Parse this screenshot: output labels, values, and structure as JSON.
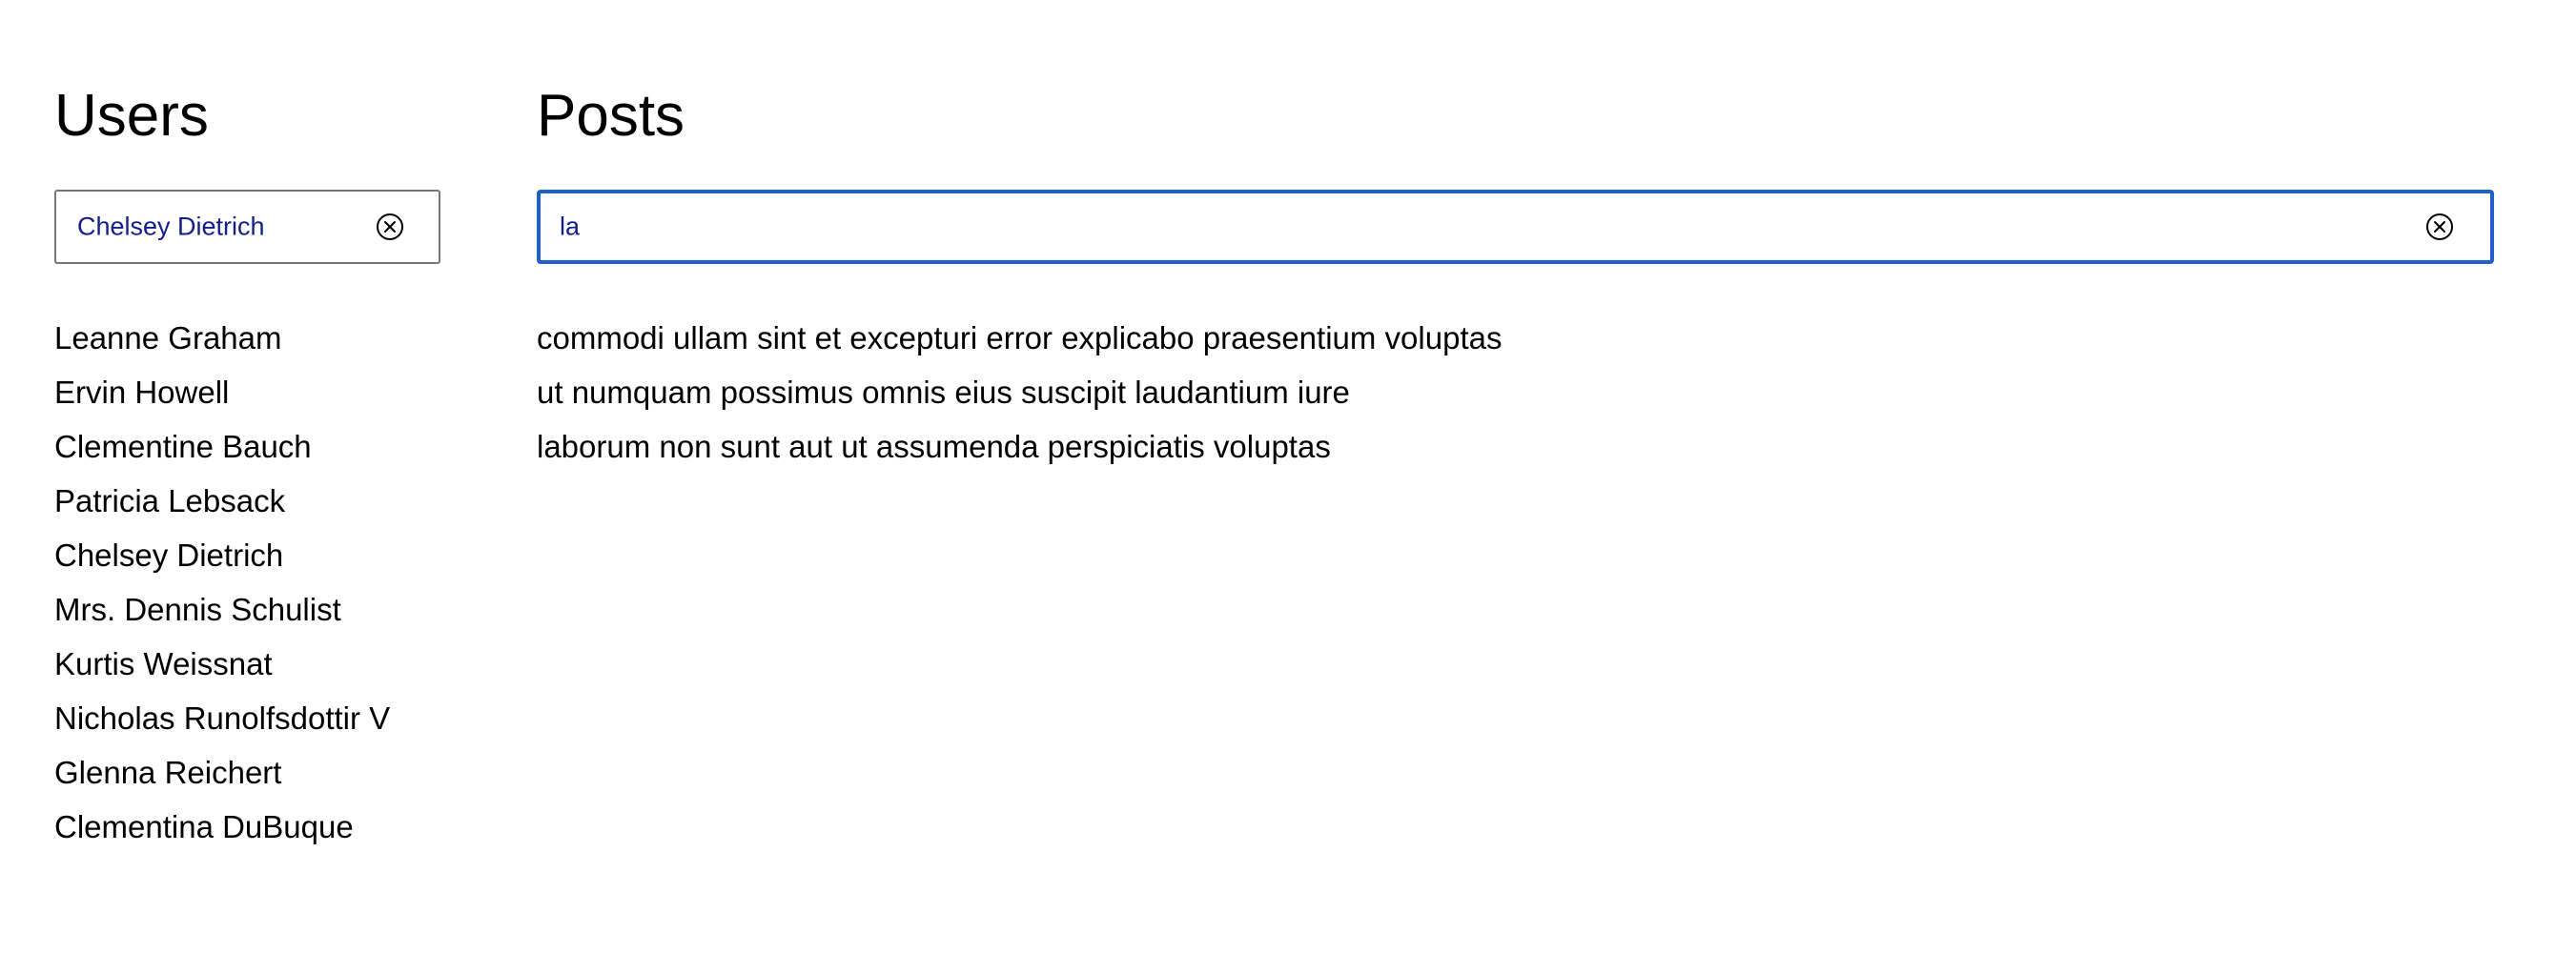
{
  "users": {
    "heading": "Users",
    "search": {
      "value": "Chelsey Dietrich"
    },
    "list": [
      "Leanne Graham",
      "Ervin Howell",
      "Clementine Bauch",
      "Patricia Lebsack",
      "Chelsey Dietrich",
      "Mrs. Dennis Schulist",
      "Kurtis Weissnat",
      "Nicholas Runolfsdottir V",
      "Glenna Reichert",
      "Clementina DuBuque"
    ]
  },
  "posts": {
    "heading": "Posts",
    "search": {
      "value": "la"
    },
    "list": [
      "commodi ullam sint et excepturi error explicabo praesentium voluptas",
      "ut numquam possimus omnis eius suscipit laudantium iure",
      "laborum non sunt aut ut assumenda perspiciatis voluptas"
    ]
  },
  "icons": {
    "clear": "close-circle-icon"
  },
  "colors": {
    "focus_border": "#1e62c9",
    "field_text": "#131d8c",
    "field_border": "#767676"
  }
}
